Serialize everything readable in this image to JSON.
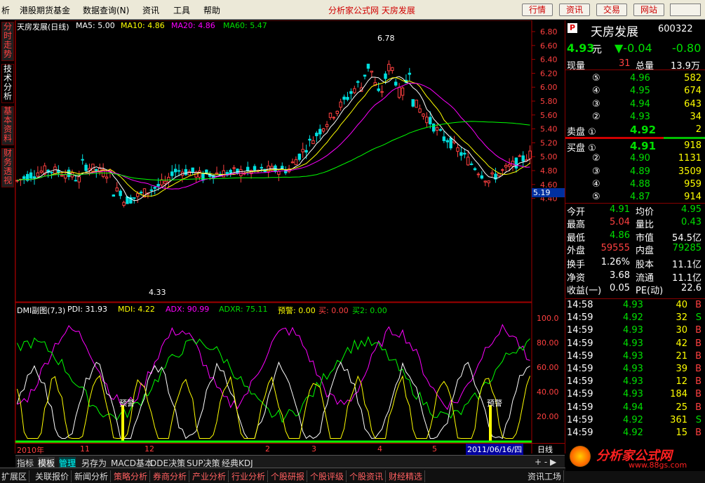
{
  "menu": [
    "港股期货基金",
    "数据查询(N)",
    "资讯",
    "工具",
    "帮助"
  ],
  "menu_prefix": "析",
  "window_title": "分析家公式网 天房发展",
  "right_buttons": [
    "行情",
    "资讯",
    "交易",
    "网站"
  ],
  "left_tabs": [
    "分时走势",
    "技术分析",
    "基本资料",
    "财务透视"
  ],
  "main_header": {
    "name": "天房发展(日线)",
    "ma5": "MA5: 5.00",
    "ma10": "MA10: 4.86",
    "ma20": "MA20: 4.86",
    "ma60": "MA60: 5.47",
    "high_label": "6.78",
    "low_label": "4.33",
    "cur_price_tag": "5.19",
    "y_ticks": [
      "6.80",
      "6.60",
      "6.40",
      "6.20",
      "6.00",
      "5.80",
      "5.60",
      "5.40",
      "5.20",
      "5.00",
      "4.80",
      "4.60",
      "4.40"
    ]
  },
  "sub_header": {
    "name": "DMI副图(7,3)",
    "pdi": "PDI: 31.93",
    "mdi": "MDI: 4.22",
    "adx": "ADX: 90.99",
    "adxr": "ADXR: 75.11",
    "warn": "预警: 0.00",
    "buy": "买: 0.00",
    "buy2": "买2: 0.00",
    "y_ticks": [
      "100.0",
      "80.00",
      "60.00",
      "40.00",
      "20.00"
    ],
    "warn_labels": [
      "预警",
      "预警"
    ]
  },
  "x_axis": [
    "2010年",
    "11",
    "12",
    "2",
    "3",
    "4",
    "5"
  ],
  "date_tag": "2011/06/16/四",
  "period_label": "日线",
  "quote": {
    "logo": "P",
    "name": "天房发展",
    "code": "600322",
    "price": "4.93",
    "price_unit": "元",
    "change": "▼-0.04",
    "change_pct": "-0.80",
    "vol_now_label": "现量",
    "vol_now": "31",
    "vol_total_label": "总量",
    "vol_total": "13.9万",
    "sells": [
      {
        "lvl": "⑤",
        "price": "4.96",
        "vol": "582"
      },
      {
        "lvl": "④",
        "price": "4.95",
        "vol": "674"
      },
      {
        "lvl": "③",
        "price": "4.94",
        "vol": "643"
      },
      {
        "lvl": "②",
        "price": "4.93",
        "vol": "34"
      },
      {
        "lvl": "卖盘 ①",
        "price": "4.92",
        "vol": "2"
      }
    ],
    "buys": [
      {
        "lvl": "买盘 ①",
        "price": "4.91",
        "vol": "918"
      },
      {
        "lvl": "②",
        "price": "4.90",
        "vol": "1131"
      },
      {
        "lvl": "③",
        "price": "4.89",
        "vol": "3509"
      },
      {
        "lvl": "④",
        "price": "4.88",
        "vol": "959"
      },
      {
        "lvl": "⑤",
        "price": "4.87",
        "vol": "914"
      }
    ],
    "stats": [
      {
        "l1": "今开",
        "v1": "4.91",
        "l2": "均价",
        "v2": "4.95",
        "c1": "green",
        "c2": "green"
      },
      {
        "l1": "最高",
        "v1": "5.04",
        "l2": "量比",
        "v2": "0.43",
        "c1": "red",
        "c2": "green"
      },
      {
        "l1": "最低",
        "v1": "4.86",
        "l2": "市值",
        "v2": "54.5亿",
        "c1": "green",
        "c2": "white"
      },
      {
        "l1": "外盘",
        "v1": "59555",
        "l2": "内盘",
        "v2": "79285",
        "c1": "red",
        "c2": "green"
      },
      {
        "l1": "换手",
        "v1": "1.26%",
        "l2": "股本",
        "v2": "11.1亿",
        "c1": "white",
        "c2": "white"
      },
      {
        "l1": "净资",
        "v1": "3.68",
        "l2": "流通",
        "v2": "11.1亿",
        "c1": "white",
        "c2": "white"
      },
      {
        "l1": "收益(一)",
        "v1": "0.05",
        "l2": "PE(动)",
        "v2": "22.6",
        "c1": "white",
        "c2": "white"
      }
    ],
    "ticks": [
      {
        "t": "14:58",
        "p": "4.93",
        "v": "40",
        "d": "B"
      },
      {
        "t": "14:59",
        "p": "4.92",
        "v": "32",
        "d": "S"
      },
      {
        "t": "14:59",
        "p": "4.93",
        "v": "30",
        "d": "B"
      },
      {
        "t": "14:59",
        "p": "4.93",
        "v": "42",
        "d": "B"
      },
      {
        "t": "14:59",
        "p": "4.93",
        "v": "21",
        "d": "B"
      },
      {
        "t": "14:59",
        "p": "4.93",
        "v": "39",
        "d": "B"
      },
      {
        "t": "14:59",
        "p": "4.93",
        "v": "12",
        "d": "B"
      },
      {
        "t": "14:59",
        "p": "4.93",
        "v": "184",
        "d": "B"
      },
      {
        "t": "14:59",
        "p": "4.94",
        "v": "25",
        "d": "B"
      },
      {
        "t": "14:59",
        "p": "4.92",
        "v": "361",
        "d": "S"
      },
      {
        "t": "14:59",
        "p": "4.92",
        "v": "15",
        "d": "B"
      }
    ]
  },
  "bottom_tabs1": [
    "指标",
    "模板",
    "管理",
    "另存为",
    "MACD基本",
    "DDE决策",
    "SUP决策",
    "经典KDJ"
  ],
  "bottom_tabs2": [
    "扩展区",
    "关联报价",
    "新闻分析",
    "策略分析",
    "券商分析",
    "产业分析",
    "行业分析",
    "个股研报",
    "个股评级",
    "个股资讯",
    "财经精选"
  ],
  "bottom_right": "资讯工场",
  "logo_text": "分析家公式网",
  "logo_url": "www.88gs.com",
  "colors": {
    "up": "#ff4040",
    "down": "#00e0e0",
    "ma5": "#ffffff",
    "ma10": "#ffff00",
    "ma20": "#ff00ff",
    "ma60": "#00ff00",
    "pdi": "#ffffff",
    "mdi": "#ffff00",
    "adx": "#ff00ff",
    "adxr": "#00ff00"
  }
}
